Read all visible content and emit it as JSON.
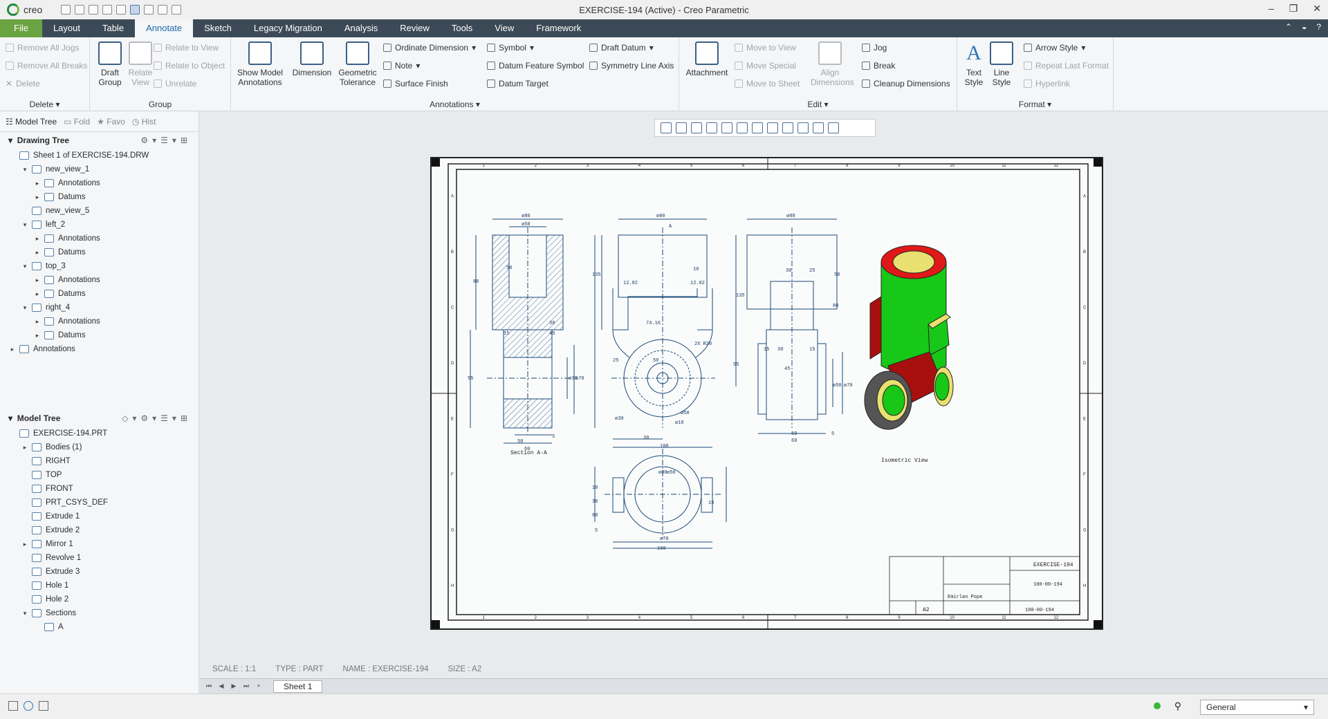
{
  "app": {
    "logo": "creo",
    "window_title": "EXERCISE-194 (Active) - Creo Parametric"
  },
  "ribbon_tabs": [
    "File",
    "Layout",
    "Table",
    "Annotate",
    "Sketch",
    "Legacy Migration",
    "Analysis",
    "Review",
    "Tools",
    "View",
    "Framework"
  ],
  "ribbon": {
    "delete_group": {
      "items": [
        "Remove All Jogs",
        "Remove All Breaks",
        "Delete"
      ],
      "label": "Delete"
    },
    "group_group": {
      "draft_group": "Draft Group",
      "relate_view": "Relate View",
      "relate_to_view": "Relate to View",
      "relate_to_object": "Relate to Object",
      "unrelate": "Unrelate",
      "label": "Group"
    },
    "annotations": {
      "show_model": "Show Model Annotations",
      "dimension": "Dimension",
      "geo_tol": "Geometric Tolerance",
      "ordinate": "Ordinate Dimension",
      "note": "Note",
      "surface_finish": "Surface Finish",
      "symbol": "Symbol",
      "datum_feature": "Datum Feature Symbol",
      "datum_target": "Datum Target",
      "draft_datum": "Draft Datum",
      "symmetry": "Symmetry Line Axis",
      "label": "Annotations"
    },
    "edit": {
      "attachment": "Attachment",
      "move_to_view": "Move to View",
      "move_special": "Move Special",
      "move_to_sheet": "Move to Sheet",
      "align": "Align Dimensions",
      "jog": "Jog",
      "break": "Break",
      "cleanup": "Cleanup Dimensions",
      "label": "Edit"
    },
    "format": {
      "text_style": "Text Style",
      "line_style": "Line Style",
      "arrow_style": "Arrow Style",
      "repeat": "Repeat Last Format",
      "hyperlink": "Hyperlink",
      "label": "Format"
    }
  },
  "left_tabs": [
    "Model Tree",
    "Fold",
    "Favo",
    "Hist"
  ],
  "drawing_tree": {
    "title": "Drawing Tree",
    "items": [
      {
        "label": "Sheet 1 of EXERCISE-194.DRW",
        "level": 0,
        "toggle": ""
      },
      {
        "label": "new_view_1",
        "level": 1,
        "toggle": "▾"
      },
      {
        "label": "Annotations",
        "level": 2,
        "toggle": "▸"
      },
      {
        "label": "Datums",
        "level": 2,
        "toggle": "▸"
      },
      {
        "label": "new_view_5",
        "level": 1,
        "toggle": ""
      },
      {
        "label": "left_2",
        "level": 1,
        "toggle": "▾"
      },
      {
        "label": "Annotations",
        "level": 2,
        "toggle": "▸"
      },
      {
        "label": "Datums",
        "level": 2,
        "toggle": "▸"
      },
      {
        "label": "top_3",
        "level": 1,
        "toggle": "▾"
      },
      {
        "label": "Annotations",
        "level": 2,
        "toggle": "▸"
      },
      {
        "label": "Datums",
        "level": 2,
        "toggle": "▸"
      },
      {
        "label": "right_4",
        "level": 1,
        "toggle": "▾"
      },
      {
        "label": "Annotations",
        "level": 2,
        "toggle": "▸"
      },
      {
        "label": "Datums",
        "level": 2,
        "toggle": "▸"
      },
      {
        "label": "Annotations",
        "level": 0,
        "toggle": "▸"
      }
    ]
  },
  "model_tree": {
    "title": "Model Tree",
    "items": [
      {
        "label": "EXERCISE-194.PRT",
        "level": 0,
        "toggle": ""
      },
      {
        "label": "Bodies (1)",
        "level": 1,
        "toggle": "▸"
      },
      {
        "label": "RIGHT",
        "level": 1,
        "toggle": ""
      },
      {
        "label": "TOP",
        "level": 1,
        "toggle": ""
      },
      {
        "label": "FRONT",
        "level": 1,
        "toggle": ""
      },
      {
        "label": "PRT_CSYS_DEF",
        "level": 1,
        "toggle": ""
      },
      {
        "label": "Extrude 1",
        "level": 1,
        "toggle": ""
      },
      {
        "label": "Extrude 2",
        "level": 1,
        "toggle": ""
      },
      {
        "label": "Mirror 1",
        "level": 1,
        "toggle": "▸"
      },
      {
        "label": "Revolve 1",
        "level": 1,
        "toggle": ""
      },
      {
        "label": "Extrude 3",
        "level": 1,
        "toggle": ""
      },
      {
        "label": "Hole 1",
        "level": 1,
        "toggle": ""
      },
      {
        "label": "Hole 2",
        "level": 1,
        "toggle": ""
      },
      {
        "label": "Sections",
        "level": 1,
        "toggle": "▾"
      },
      {
        "label": "A",
        "level": 2,
        "toggle": ""
      }
    ]
  },
  "drawing": {
    "section_label": "Section A-A",
    "iso_label": "Isometric View",
    "title_name": "EXERCISE-194",
    "drawing_no": "100-00-194",
    "size": "A2",
    "author": "Emirlan Pope",
    "dims": [
      "ø80",
      "ø50",
      "50",
      "80",
      "135",
      "55",
      "30",
      "15",
      "45",
      "ø30",
      "ø70",
      "5",
      "60",
      "50",
      "ø80",
      "A",
      "12.82",
      "12.82",
      "10",
      "74.16",
      "2X R20",
      "25",
      "50",
      "ø30",
      "ø50",
      "ø10",
      "30",
      "100",
      "ø80",
      "30",
      "25",
      "50",
      "80",
      "135",
      "55",
      "30",
      "15",
      "15",
      "45",
      "ø50",
      "ø70",
      "50",
      "60",
      "5",
      "ø80",
      "ø50",
      "10",
      "30",
      "60",
      "5",
      "15",
      "ø70",
      "100"
    ],
    "zones_h": [
      "1",
      "2",
      "3",
      "4",
      "5",
      "6",
      "7",
      "8",
      "9",
      "10",
      "11",
      "12"
    ],
    "zones_v": [
      "A",
      "B",
      "C",
      "D",
      "E",
      "F",
      "G",
      "H"
    ]
  },
  "status": {
    "scale": "SCALE : 1:1",
    "type": "TYPE : PART",
    "name": "NAME : EXERCISE-194",
    "size": "SIZE : A2"
  },
  "sheet_tab": "Sheet 1",
  "filter": "General",
  "colors": {
    "tab_bar": "#3c4a57",
    "file_tab": "#6aa341",
    "line": "#1a4a78",
    "red": "#e01818",
    "green": "#18c818",
    "yellow": "#e8e070",
    "dark_red": "#a81010"
  }
}
